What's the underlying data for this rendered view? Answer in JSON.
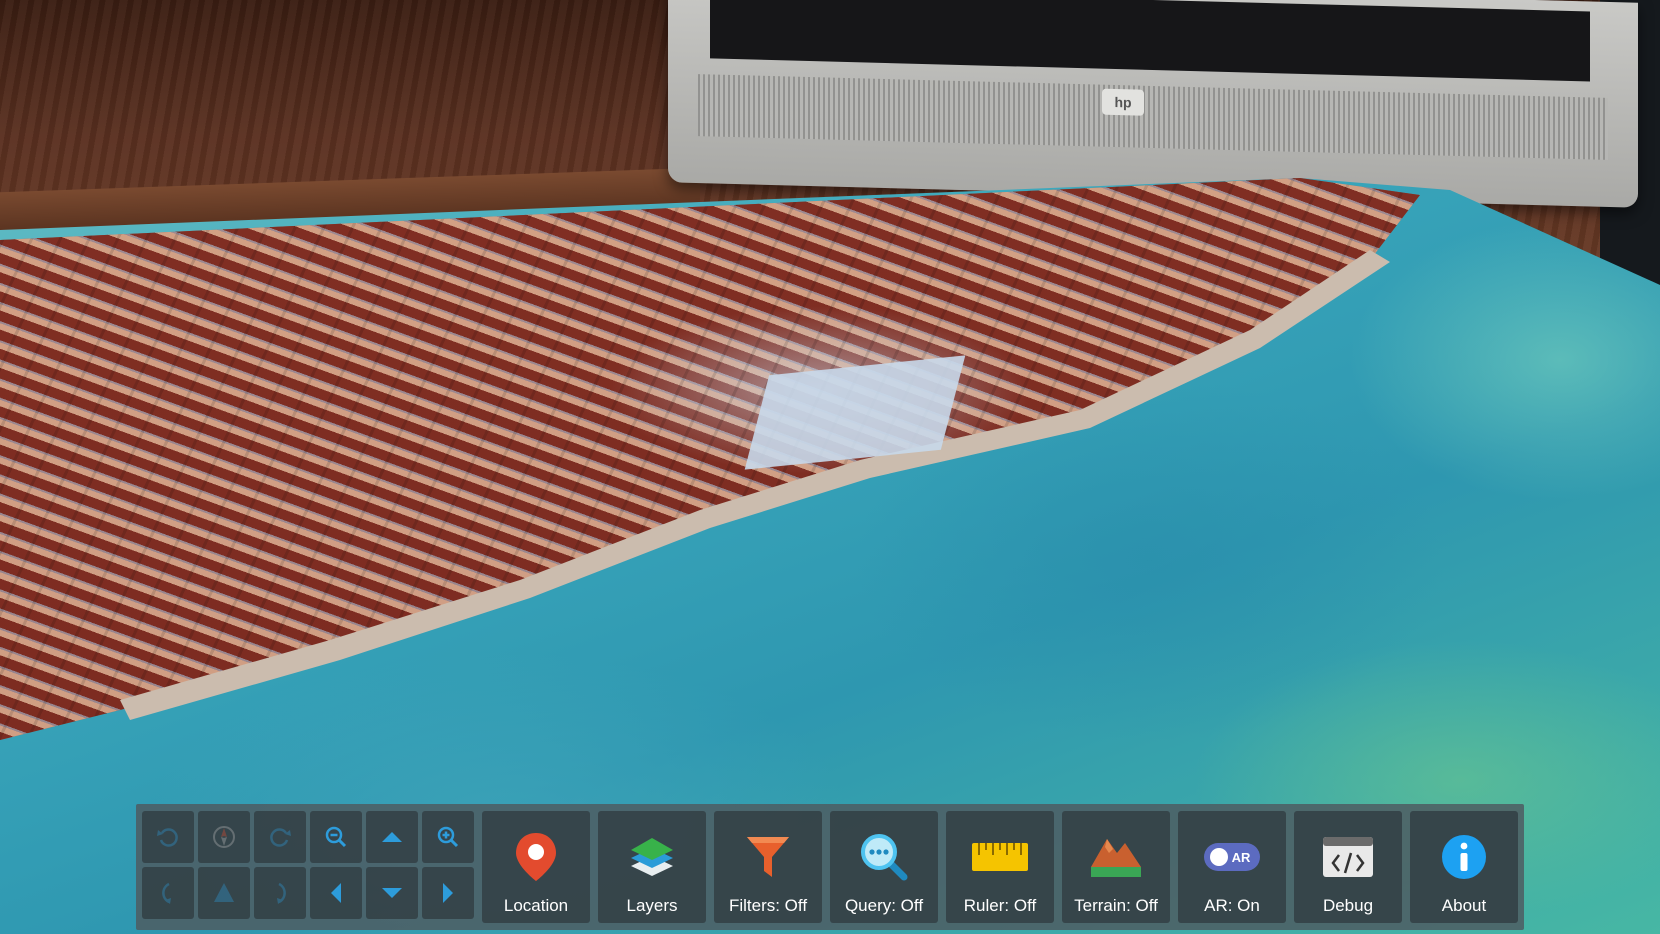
{
  "app": {
    "monitor_brand": "hp"
  },
  "navigation": {
    "buttons": [
      {
        "name": "rotate-left",
        "enabled": false
      },
      {
        "name": "compass",
        "enabled": false
      },
      {
        "name": "rotate-right",
        "enabled": false
      },
      {
        "name": "zoom-out",
        "enabled": true
      },
      {
        "name": "pan-up",
        "enabled": true
      },
      {
        "name": "zoom-in",
        "enabled": true
      },
      {
        "name": "tilt-left",
        "enabled": false
      },
      {
        "name": "pitch",
        "enabled": false
      },
      {
        "name": "tilt-right",
        "enabled": false
      },
      {
        "name": "pan-left",
        "enabled": true
      },
      {
        "name": "pan-down",
        "enabled": true
      },
      {
        "name": "pan-right",
        "enabled": true
      }
    ]
  },
  "toolbar": {
    "location_label": "Location",
    "layers_label": "Layers",
    "filters_label": "Filters: Off",
    "query_label": "Query: Off",
    "ruler_label": "Ruler: Off",
    "terrain_label": "Terrain: Off",
    "ar_label": "AR: On",
    "ar_badge": "AR",
    "debug_label": "Debug",
    "about_label": "About"
  },
  "colors": {
    "toolbar_bg": "#4e5c62",
    "button_bg": "#344248",
    "nav_icon_active": "#2d9cdb",
    "location_pin": "#e34b2e",
    "filter_funnel": "#e8602c",
    "query_magnifier": "#4ec3f0",
    "ruler": "#f5c400",
    "ar_toggle": "#5c6bc0",
    "about_circle": "#1da1f2"
  }
}
